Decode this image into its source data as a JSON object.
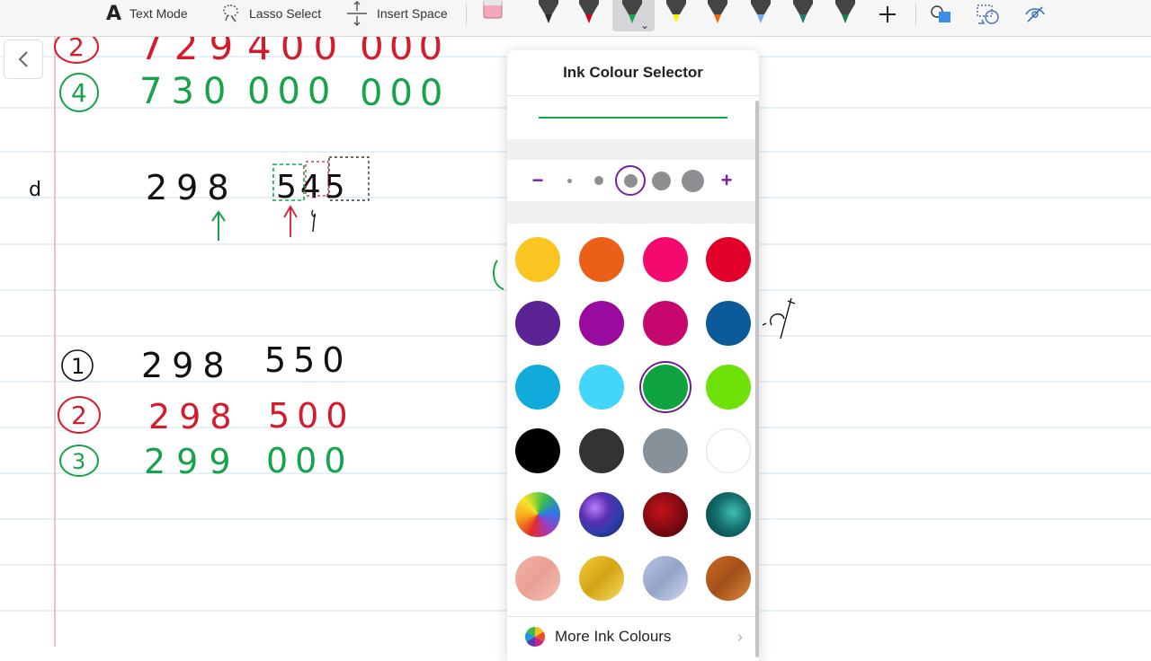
{
  "toolbar": {
    "text_mode_label": "Text Mode",
    "lasso_select_label": "Lasso Select",
    "insert_space_label": "Insert Space",
    "pens": [
      {
        "name": "black-pen",
        "color": "#2b2b2b"
      },
      {
        "name": "red-pen",
        "color": "#d0021b"
      },
      {
        "name": "green-pen",
        "color": "#16a34a",
        "selected": true
      },
      {
        "name": "yellow-highlighter",
        "color": "#f4f100"
      },
      {
        "name": "orange-pen",
        "color": "#e8630a"
      },
      {
        "name": "blue-highlighter",
        "color": "#74a6e8"
      },
      {
        "name": "teal-pen",
        "color": "#1f7a6a"
      },
      {
        "name": "dark-green-pen",
        "color": "#11803f"
      }
    ]
  },
  "ink_selector": {
    "title": "Ink Colour Selector",
    "preview_color": "#17a84a",
    "size_options": [
      "−",
      "+"
    ],
    "selected_size_index": 2,
    "colors": [
      [
        "#fac421",
        "#ec5f19",
        "#f40a6e",
        "#e1002a"
      ],
      [
        "#5c2394",
        "#990a9e",
        "#c6086e",
        "#0c5a97"
      ],
      [
        "#10abdc",
        "#42d6fb",
        "#0fa340",
        "#6ee208"
      ],
      [
        "#000000",
        "#333336",
        "#86919a",
        "#ffffff"
      ],
      [
        "rainbow-glitter",
        "galaxy",
        "red-marble",
        "teal-marble"
      ],
      [
        "rose-gold-texture",
        "gold-texture",
        "silver-texture",
        "bronze-texture"
      ]
    ],
    "selected_color": "#0fa340",
    "more_label": "More Ink Colours"
  },
  "notebook": {
    "rows": [
      {
        "marker": "2",
        "numbers": [
          "729",
          "400",
          "000"
        ],
        "color": "#d41c2c"
      },
      {
        "marker": "4",
        "numbers": [
          "730",
          "000",
          "000"
        ],
        "color": "#16a34a"
      },
      {
        "marker": "d",
        "numbers": [
          "298",
          "545"
        ],
        "color": "#111111"
      },
      {
        "marker": "1",
        "numbers": [
          "298",
          "550"
        ],
        "color": "#111111"
      },
      {
        "marker": "2",
        "numbers": [
          "298",
          "500"
        ],
        "color": "#d41c2c"
      },
      {
        "marker": "3",
        "numbers": [
          "299",
          "000"
        ],
        "color": "#16a34a"
      }
    ]
  }
}
